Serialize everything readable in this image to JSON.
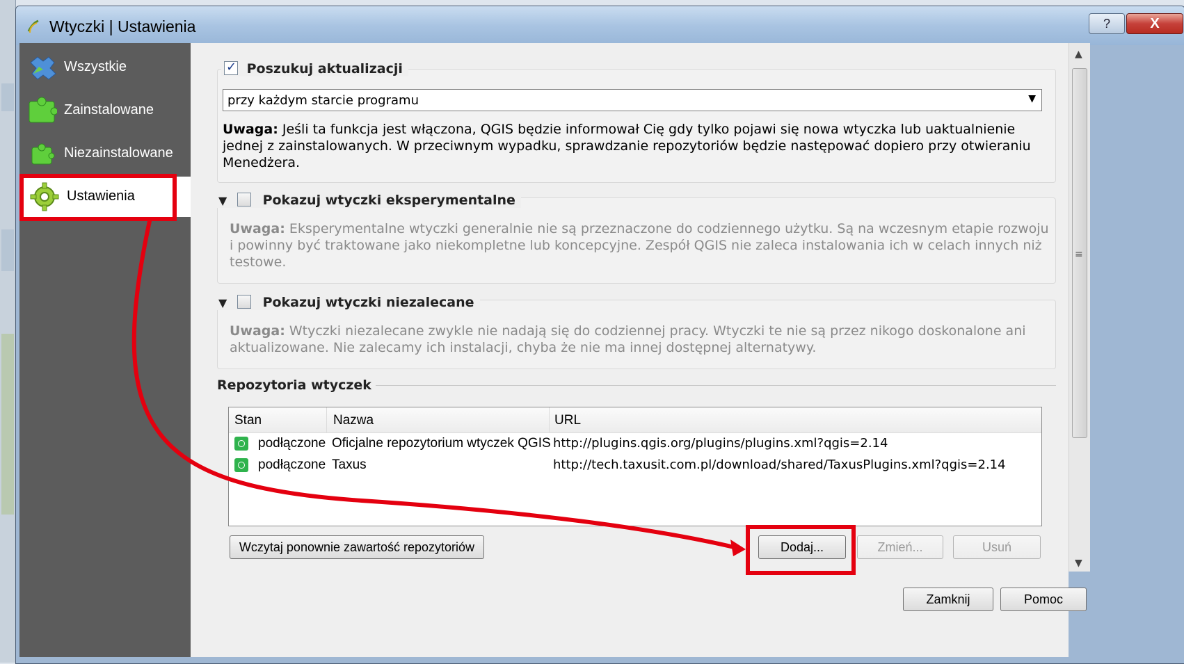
{
  "window": {
    "title": "Wtyczki | Ustawienia",
    "help_glyph": "?",
    "close_glyph": "X"
  },
  "sidebar": {
    "items": [
      {
        "label": "Wszystkie",
        "icon": "puzzle-all-icon"
      },
      {
        "label": "Zainstalowane",
        "icon": "puzzle-installed-icon"
      },
      {
        "label": "Niezainstalowane",
        "icon": "puzzle-uninstalled-icon"
      },
      {
        "label": "Ustawienia",
        "icon": "gear-icon",
        "active": true
      }
    ]
  },
  "updates": {
    "title": "Poszukuj aktualizacji",
    "checked": true,
    "frequency_selected": "przy każdym starcie programu",
    "note_label": "Uwaga:",
    "note_text": " Jeśli ta funkcja jest włączona, QGIS będzie informował Cię gdy tylko pojawi się nowa wtyczka lub uaktualnienie jednej z zainstalowanych. W przeciwnym wypadku, sprawdzanie repozytoriów będzie następować dopiero przy otwieraniu Menedżera."
  },
  "experimental": {
    "title": "Pokazuj wtyczki eksperymentalne",
    "checked": false,
    "note_label": "Uwaga:",
    "note_text": " Eksperymentalne wtyczki generalnie nie są przeznaczone do codziennego użytku. Są na wczesnym etapie rozwoju i powinny być traktowane jako niekompletne lub koncepcyjne. Zespół QGIS nie zaleca instalowania ich w celach innych niż testowe."
  },
  "deprecated": {
    "title": "Pokazuj wtyczki niezalecane",
    "checked": false,
    "note_label": "Uwaga:",
    "note_text": " Wtyczki niezalecane zwykle nie nadają się do codziennej pracy. Wtyczki te nie są przez nikogo doskonalone ani aktualizowane. Nie zalecamy ich instalacji, chyba że nie ma innej dostępnej alternatywy."
  },
  "repositories": {
    "title": "Repozytoria wtyczek",
    "columns": [
      "Stan",
      "Nazwa",
      "URL"
    ],
    "rows": [
      {
        "status": "podłączone",
        "name": "Oficjalne repozytorium wtyczek QGIS",
        "url": "http://plugins.qgis.org/plugins/plugins.xml?qgis=2.14"
      },
      {
        "status": "podłączone",
        "name": "Taxus",
        "url": "http://tech.taxusit.com.pl/download/shared/TaxusPlugins.xml?qgis=2.14"
      }
    ],
    "reload_label": "Wczytaj ponownie zawartość repozytoriów",
    "add_label": "Dodaj...",
    "edit_label": "Zmień...",
    "delete_label": "Usuń"
  },
  "footer": {
    "close_label": "Zamknij",
    "help_label": "Pomoc"
  },
  "colors": {
    "highlight": "#e4000f",
    "sidebar_bg": "#5c5c5c",
    "status_ok": "#2fb34d"
  }
}
